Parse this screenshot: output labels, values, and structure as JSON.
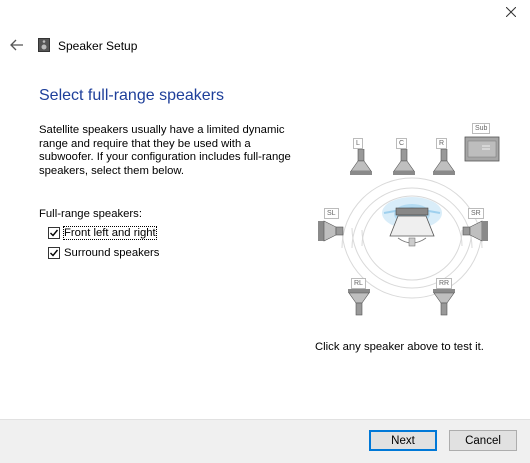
{
  "window": {
    "title": "Speaker Setup"
  },
  "page": {
    "heading": "Select full-range speakers",
    "description": "Satellite speakers usually have a limited dynamic range and require that they be used with a subwoofer.  If your configuration includes full-range speakers, select them below.",
    "full_range_label": "Full-range speakers:",
    "checkboxes": [
      {
        "label": "Front left and right",
        "checked": true
      },
      {
        "label": "Surround speakers",
        "checked": true
      }
    ],
    "test_hint": "Click any speaker above to test it."
  },
  "speakers": {
    "front_left": "L",
    "center": "C",
    "front_right": "R",
    "subwoofer": "Sub",
    "side_left": "SL",
    "side_right": "SR",
    "rear_left": "RL",
    "rear_right": "RR"
  },
  "buttons": {
    "next": "Next",
    "cancel": "Cancel"
  },
  "icons": {
    "close": "close-icon",
    "back": "back-arrow-icon",
    "app": "speaker-icon"
  }
}
